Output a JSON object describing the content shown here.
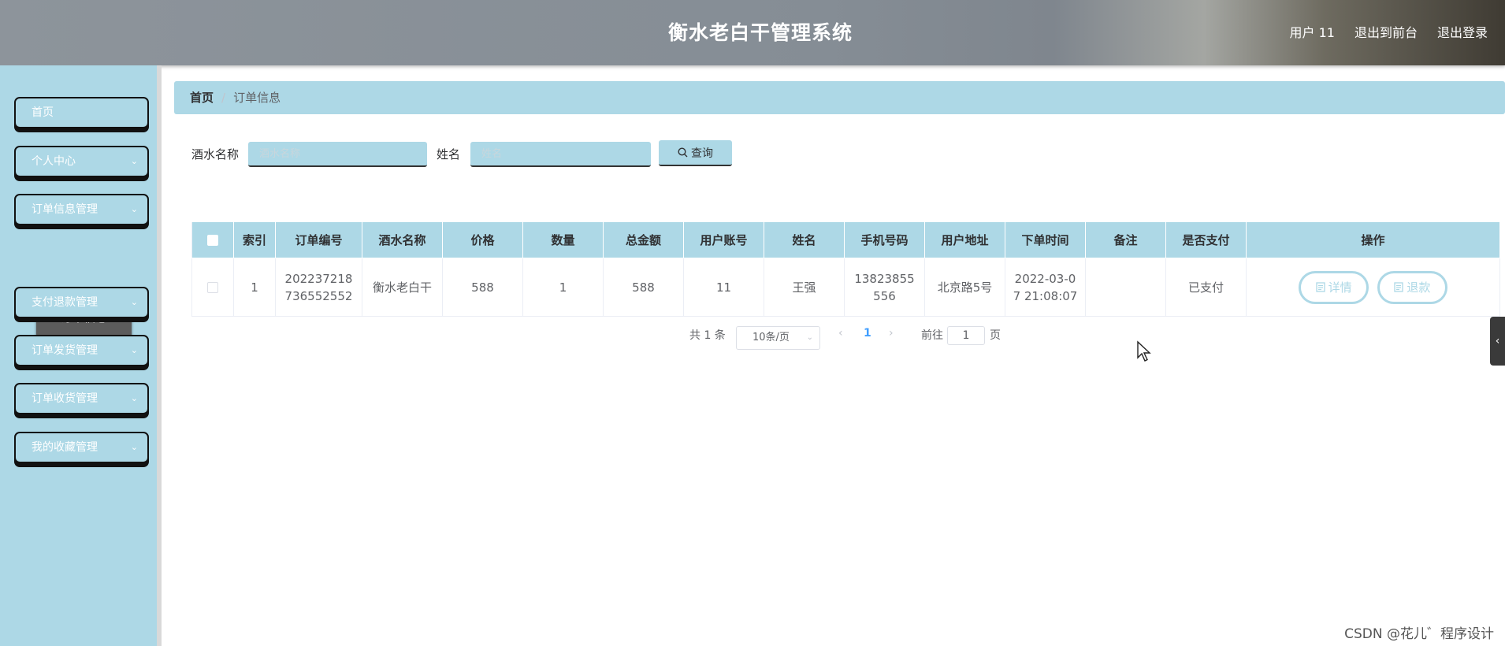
{
  "header": {
    "title": "衡水老白干管理系统",
    "user": "用户 11",
    "back_front": "退出到前台",
    "logout": "退出登录"
  },
  "sidebar": {
    "items": [
      {
        "label": "首页",
        "has_arrow": false
      },
      {
        "label": "个人中心",
        "has_arrow": true
      },
      {
        "label": "订单信息管理",
        "has_arrow": true
      },
      {
        "label": "支付退款管理",
        "has_arrow": true
      },
      {
        "label": "订单发货管理",
        "has_arrow": true
      },
      {
        "label": "订单收货管理",
        "has_arrow": true
      },
      {
        "label": "我的收藏管理",
        "has_arrow": true
      }
    ],
    "sub_item": "订单信息",
    "chevron": "⌄"
  },
  "breadcrumb": {
    "home": "首页",
    "separator": "/",
    "current": "订单信息"
  },
  "search": {
    "wine_label": "酒水名称",
    "wine_placeholder": "酒水名称",
    "name_label": "姓名",
    "name_placeholder": "姓名",
    "button": "查询",
    "button_icon": "search-icon"
  },
  "table": {
    "headers": [
      "索引",
      "订单编号",
      "酒水名称",
      "价格",
      "数量",
      "总金额",
      "用户账号",
      "姓名",
      "手机号码",
      "用户地址",
      "下单时间",
      "备注",
      "是否支付",
      "操作"
    ],
    "rows": [
      {
        "index": "1",
        "order_no": "202237218736552552",
        "wine": "衡水老白干",
        "price": "588",
        "qty": "1",
        "total": "588",
        "account": "11",
        "name": "王强",
        "phone": "13823855556",
        "address": "北京路5号",
        "time": "2022-03-07 21:08:07",
        "note": "",
        "paid": "已支付",
        "detail": "详情",
        "refund": "退款"
      }
    ]
  },
  "pagination": {
    "total": "共 1 条",
    "page_size": "10条/页",
    "prev": "‹",
    "current_page": "1",
    "next": "›",
    "goto_prefix": "前往",
    "goto_value": "1",
    "goto_suffix": "页"
  },
  "collapse_tab": "‹",
  "watermark": "CSDN @花儿゛程序设计",
  "colors": {
    "accent": "#add8e6",
    "sub_active": "#5c5c5c",
    "page_active": "#409eff"
  }
}
